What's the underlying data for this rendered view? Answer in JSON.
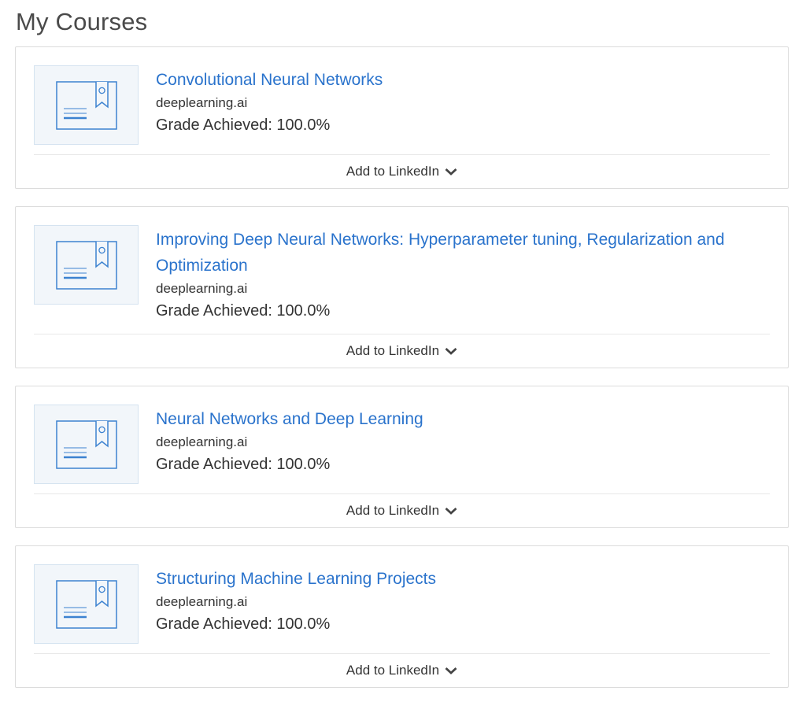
{
  "page": {
    "title": "My Courses"
  },
  "colors": {
    "link": "#2a73cc",
    "text": "#333333",
    "card_border": "#dcdcdc",
    "thumb_bg": "#f2f6fa",
    "thumb_icon": "#3c82d0"
  },
  "icons": {
    "thumbnail": "certificate-icon",
    "toggle": "chevron-down-icon"
  },
  "courses": [
    {
      "title": "Convolutional Neural Networks",
      "partner": "deeplearning.ai",
      "grade": "Grade Achieved: 100.0%",
      "linkedin_label": "Add to LinkedIn"
    },
    {
      "title": "Improving Deep Neural Networks: Hyperparameter tuning, Regularization and Optimization",
      "partner": "deeplearning.ai",
      "grade": "Grade Achieved: 100.0%",
      "linkedin_label": "Add to LinkedIn"
    },
    {
      "title": "Neural Networks and Deep Learning",
      "partner": "deeplearning.ai",
      "grade": "Grade Achieved: 100.0%",
      "linkedin_label": "Add to LinkedIn"
    },
    {
      "title": "Structuring Machine Learning Projects",
      "partner": "deeplearning.ai",
      "grade": "Grade Achieved: 100.0%",
      "linkedin_label": "Add to LinkedIn"
    }
  ]
}
